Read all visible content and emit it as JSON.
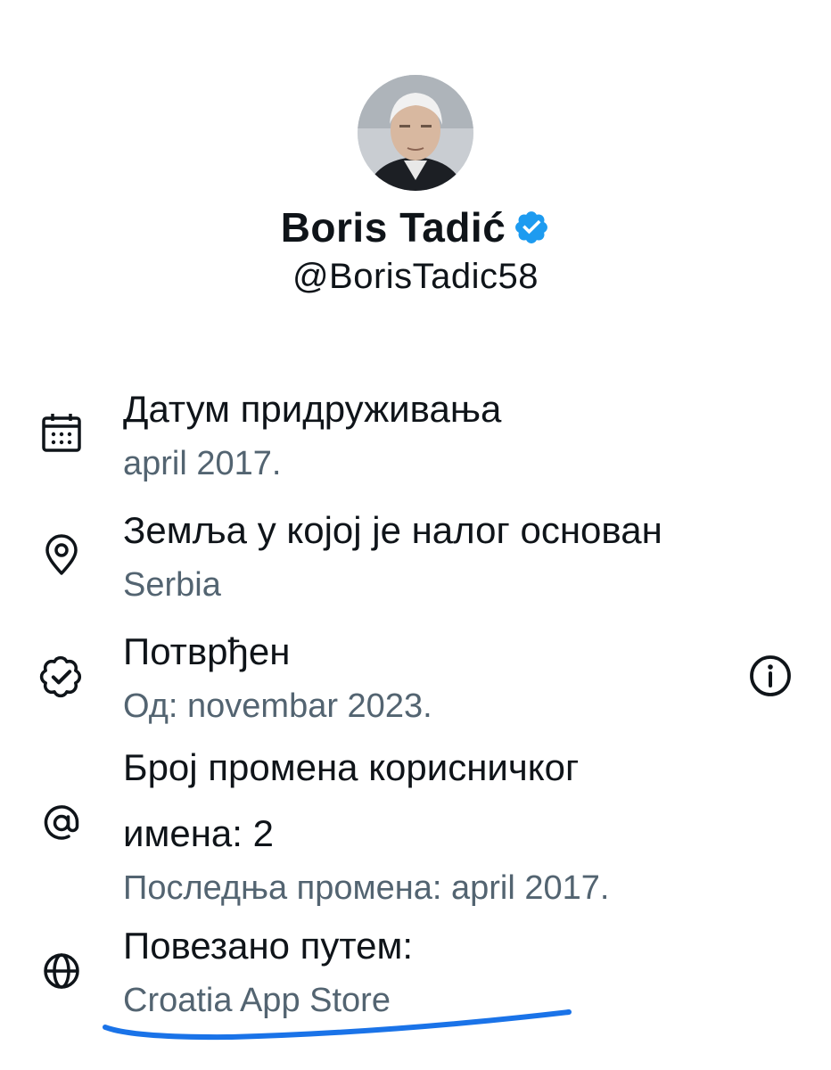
{
  "profile": {
    "display_name": "Boris Tadić",
    "handle": "@BorisTadic58",
    "verified_color": "#1d9bf0"
  },
  "about": {
    "joined": {
      "title": "Датум придруживања",
      "value": "april 2017.",
      "icon": "calendar-icon"
    },
    "country": {
      "title": "Земља у којој је налог основан",
      "value": "Serbia",
      "icon": "location-pin-icon"
    },
    "verified": {
      "title": "Потврђен",
      "value": "Од: novembar 2023.",
      "icon": "verified-badge-icon"
    },
    "username_changes": {
      "title_line1": "Број промена корисничког",
      "title_line2": "имена: 2",
      "value": "Последња промена: april 2017.",
      "icon": "at-sign-icon"
    },
    "connected_via": {
      "title": "Повезано путем:",
      "value": "Croatia App Store",
      "icon": "globe-icon",
      "highlight_color": "#1a73e8"
    }
  }
}
